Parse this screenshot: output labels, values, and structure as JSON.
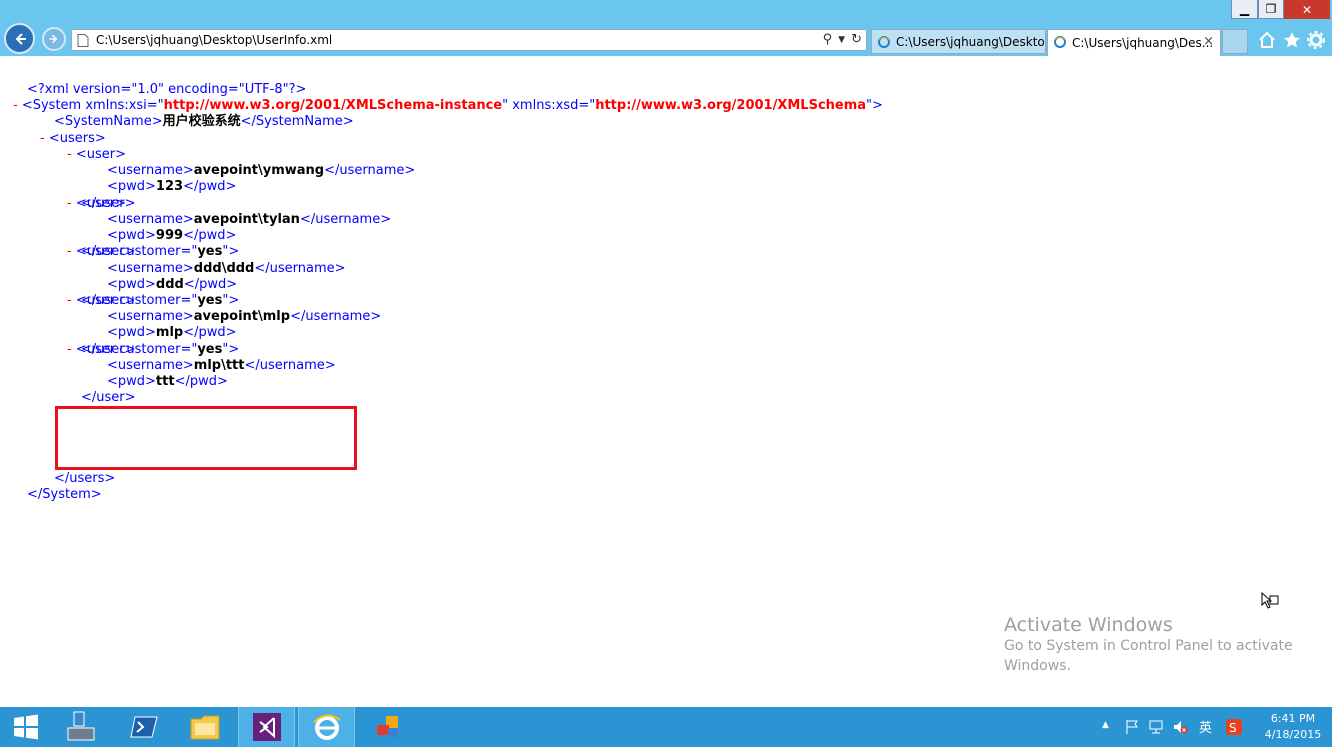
{
  "browser": {
    "address": "C:\\Users\\jqhuang\\Desktop\\UserInfo.xml",
    "tabs": [
      {
        "label": "C:\\Users\\jqhuang\\Deskto..."
      },
      {
        "label": "C:\\Users\\jqhuang\\Des...",
        "active": true
      }
    ],
    "close_tab_glyph": "×"
  },
  "xml": {
    "decl": "<?xml version=\"1.0\" encoding=\"UTF-8\"?>",
    "root_open_prefix": "<System xmlns:xsi=\"",
    "xsi_url": "http://www.w3.org/2001/XMLSchema-instance",
    "mid_attr": "\" xmlns:xsd=\"",
    "xsd_url": "http://www.w3.org/2001/XMLSchema",
    "root_open_suffix": "\">",
    "systemname_open": "<SystemName>",
    "systemname_value": "用户校验系统",
    "systemname_close": "</SystemName>",
    "users_open": "<users>",
    "users_close": "</users>",
    "root_close": "</System>",
    "collapse_glyph": "-",
    "user_open_plain": "<user>",
    "user_open_attr_prefix": "<user customer=\"",
    "user_attr_value": "yes",
    "user_open_attr_suffix": "\">",
    "user_close": "</user>",
    "username_open": "<username>",
    "username_close": "</username>",
    "pwd_open": "<pwd>",
    "pwd_close": "</pwd>",
    "users": [
      {
        "username": "avepoint\\ymwang",
        "pwd": "123",
        "customer": false
      },
      {
        "username": "avepoint\\tylan",
        "pwd": "999",
        "customer": false
      },
      {
        "username": "ddd\\ddd",
        "pwd": "ddd",
        "customer": true
      },
      {
        "username": "avepoint\\mlp",
        "pwd": "mlp",
        "customer": true
      },
      {
        "username": "mlp\\ttt",
        "pwd": "ttt",
        "customer": true,
        "highlighted": true
      }
    ]
  },
  "watermark": {
    "title": "Activate Windows",
    "subtitle": "Go to System in Control Panel to activate Windows."
  },
  "taskbar": {
    "clock_time": "6:41 PM",
    "clock_date": "4/18/2015"
  },
  "colors": {
    "titlebar": "#6bc6ef",
    "taskbar": "#2b95d4",
    "highlight_box": "#e8131a"
  }
}
